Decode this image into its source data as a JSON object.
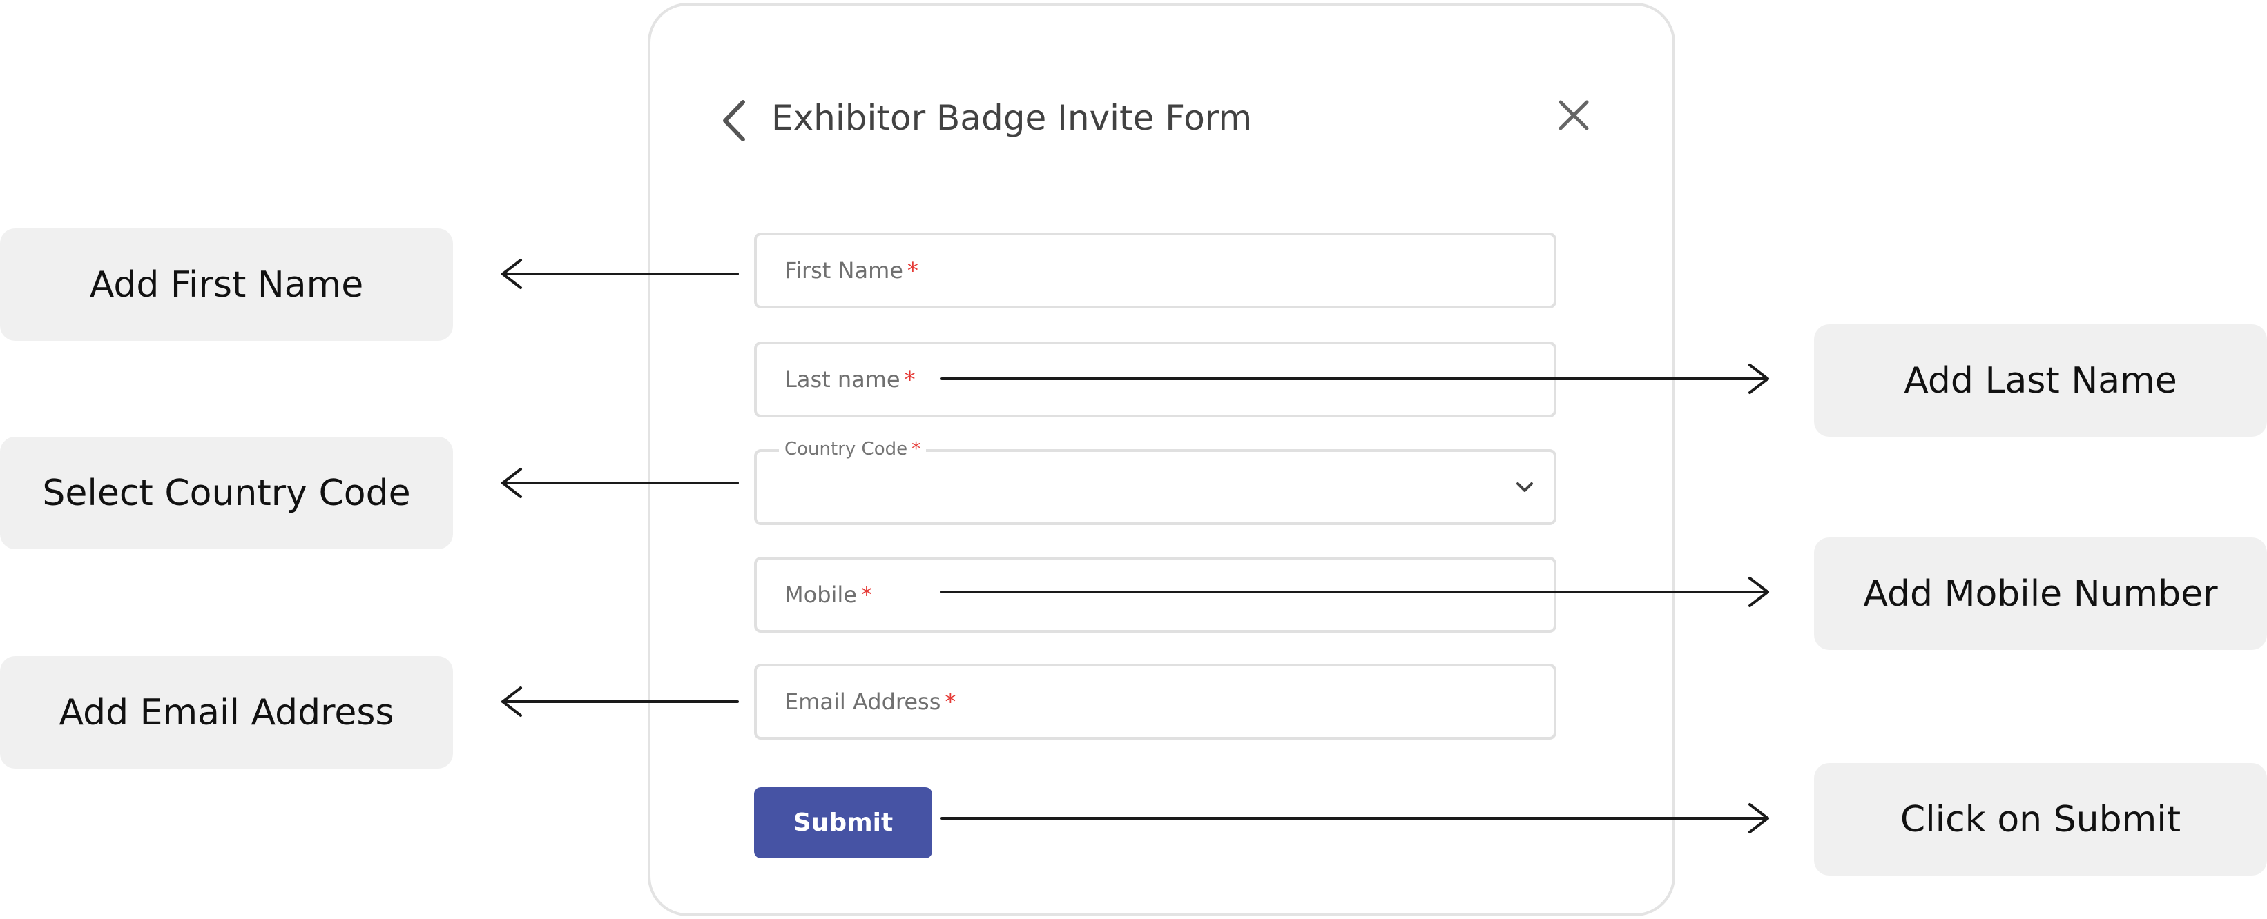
{
  "form": {
    "title": "Exhibitor Badge Invite Form",
    "required_mark": "*",
    "fields": {
      "first_name": {
        "label": "First Name",
        "value": ""
      },
      "last_name": {
        "label": "Last name",
        "value": ""
      },
      "country_code": {
        "label": "Country Code",
        "selected": ""
      },
      "mobile": {
        "label": "Mobile",
        "value": ""
      },
      "email": {
        "label": "Email Address",
        "value": ""
      }
    },
    "submit_label": "Submit",
    "colors": {
      "submit_bg": "#4653a4",
      "required": "#e53935"
    }
  },
  "callouts": {
    "first_name": "Add First Name",
    "last_name": "Add Last Name",
    "country_code": "Select Country Code",
    "mobile": "Add Mobile Number",
    "email": "Add Email Address",
    "submit": "Click on Submit"
  },
  "icons": [
    "chevron-left-icon",
    "close-icon",
    "chevron-down-icon",
    "arrow-icon"
  ]
}
